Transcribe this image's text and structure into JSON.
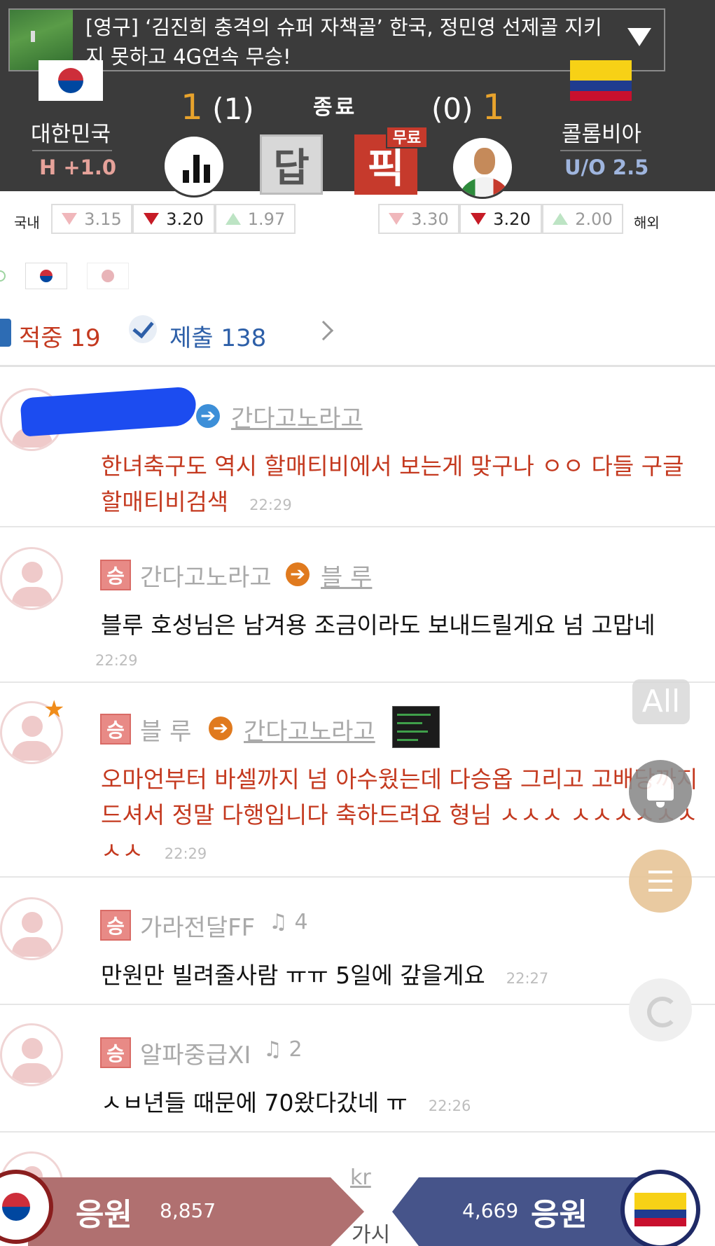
{
  "news": {
    "headline": "[영구] ‘김진희 충격의 슈퍼 자책골’ 한국, 정민영 선제골 지키지 못하고 4G연속 무승!"
  },
  "match": {
    "home": {
      "name": "대한민국",
      "handicap": "H +1.0",
      "score": "1",
      "score_half": "(1)"
    },
    "away": {
      "name": "콜롬비아",
      "overunder": "U/O 2.5",
      "score": "1",
      "score_half": "(0)"
    },
    "status": "종료",
    "buttons": {
      "answer": "답",
      "pick": "픽",
      "free": "무료"
    }
  },
  "odds": {
    "domestic_label": "국내",
    "overseas_label": "해외",
    "domestic": [
      "3.15",
      "3.20",
      "1.97"
    ],
    "overseas": [
      "3.30",
      "3.20",
      "2.00"
    ]
  },
  "stats": {
    "hit_label": "적중",
    "hit_count": "19",
    "submit_label": "제출",
    "submit_count": "138"
  },
  "comments": [
    {
      "from": "",
      "to": "간다고노라고",
      "text": "한녀축구도 역시 할매티비에서 보는게 맞구나 ㅇㅇ 다들 구글할매티비검색",
      "time": "22:29"
    },
    {
      "badge": "승",
      "from": "간다고노라고",
      "to": "블 루",
      "text": "블루 호성님은 남겨용 조금이라도 보내드릴게요 넘 고맙네",
      "time": "22:29"
    },
    {
      "badge": "승",
      "from": "블 루",
      "to": "간다고노라고",
      "text": "오마언부터 바셀까지 넘 아수웠는데 다승옵 그리고 고배당까지 드셔서 정말 다행입니다 축하드려요 형님 ㅅㅅㅅ ㅅㅅㅅㅅㅅㅅㅅㅅ",
      "time": "22:29"
    },
    {
      "badge": "승",
      "from": "가라전달FF",
      "bell": "4",
      "text": "만원만 빌려줄사람 ㅠㅠ 5일에 갚을게요",
      "time": "22:27"
    },
    {
      "badge": "승",
      "from": "알파중급XI",
      "bell": "2",
      "text": "ㅅㅂ년들 때문에 70왔다갔네 ㅠ",
      "time": "22:26"
    }
  ],
  "peek": {
    "suffix": "kr",
    "partial": "가시"
  },
  "fab": {
    "all": "All"
  },
  "cheer": {
    "home_label": "응원",
    "home_count": "8,857",
    "away_label": "응원",
    "away_count": "4,669"
  },
  "colors": {
    "accent_red": "#c4391f",
    "header_bg": "#3b3b3b",
    "score_gold": "#e8a32c",
    "away_blue": "#46548a",
    "home_red": "#b07070"
  }
}
